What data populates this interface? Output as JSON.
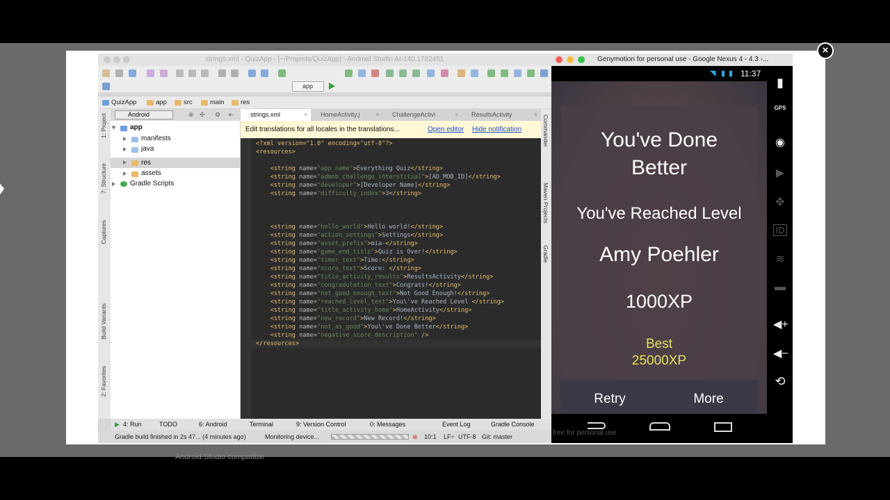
{
  "studio": {
    "title": "strings.xml - QuizApp - [~/Projects/QuizApp] - Android Studio AI-140.1782451",
    "run_config": "app",
    "breadcrumb": [
      "QuizApp",
      "app",
      "src",
      "main",
      "res"
    ],
    "project_view": "Android",
    "tree": [
      "app",
      "manifests",
      "java",
      "res",
      "assets",
      "Gradle Scripts"
    ],
    "tabs": [
      "strings.xml",
      "HomeActivity.j",
      "ChallengeActivi",
      "ResultsActivity"
    ],
    "notice": {
      "text": "Edit translations for all locales in the translations...",
      "open": "Open editor",
      "hide": "Hide notification"
    },
    "left_tools": [
      "1: Project",
      "7: Structure",
      "Captures",
      "Build Variants",
      "2: Favorites"
    ],
    "right_tools": [
      "Commander",
      "Maven Projects",
      "Gradle"
    ],
    "code": [
      {
        "kind": "decl",
        "text": "<?xml version=\"1.0\" encoding=\"utf-8\"?>"
      },
      {
        "kind": "tag",
        "text": "<resources>"
      },
      {
        "kind": "blank",
        "text": ""
      },
      {
        "kind": "str",
        "name": "app_name",
        "value": "Everything Quiz"
      },
      {
        "kind": "str",
        "name": "admob_challenge_interstitial",
        "value": "[AD_MOB_ID]"
      },
      {
        "kind": "str",
        "name": "developer",
        "value": "[Developer Name]"
      },
      {
        "kind": "str",
        "name": "difficulty_index",
        "value": "3"
      },
      {
        "kind": "blank",
        "text": ""
      },
      {
        "kind": "blank",
        "text": ""
      },
      {
        "kind": "blank",
        "text": ""
      },
      {
        "kind": "str",
        "name": "hello_world",
        "value": "Hello world!"
      },
      {
        "kind": "str",
        "name": "action_settings",
        "value": "Settings"
      },
      {
        "kind": "str",
        "name": "asset_prefix",
        "value": "mia-"
      },
      {
        "kind": "str",
        "name": "game_end_title",
        "value": "Quiz is Over!"
      },
      {
        "kind": "str",
        "name": "timer_text",
        "value": "Time:"
      },
      {
        "kind": "str",
        "name": "score_text",
        "value": "Score: "
      },
      {
        "kind": "str",
        "name": "title_activity_results",
        "value": "ResultsActivity"
      },
      {
        "kind": "str",
        "name": "congradulation_text",
        "value": "Congrats!"
      },
      {
        "kind": "str",
        "name": "not_good_enough_text",
        "value": "Not Good Enough!"
      },
      {
        "kind": "str",
        "name": "reached_level_text",
        "value": "You\\'ve Reached Level "
      },
      {
        "kind": "str",
        "name": "title_activity_home",
        "value": "HomeActivity"
      },
      {
        "kind": "str",
        "name": "new_record",
        "value": "New Record!"
      },
      {
        "kind": "str",
        "name": "not_as_good",
        "value": "You\\'ve Done Better"
      },
      {
        "kind": "empty",
        "name": "negative_score_description"
      },
      {
        "kind": "tag",
        "text": "</resources>"
      }
    ],
    "bottom_tabs": [
      "4: Run",
      "TODO",
      "6: Android",
      "Terminal",
      "9: Version Control",
      "0: Messages",
      "Event Log",
      "Gradle Console"
    ],
    "status": {
      "message": "Gradle build finished in 2s 47... (4 minutes ago)",
      "task": "Monitoring device...",
      "position": "10:1",
      "line_sep": "LF÷",
      "encoding": "UTF-8",
      "vcs": "Git: master"
    }
  },
  "geny": {
    "title": "Genymotion for personal use - Google Nexus 4 - 4.3 -...",
    "time": "11:37",
    "side": [
      "GPS"
    ],
    "watermark": "free for personal use"
  },
  "app": {
    "heading": "You've Done Better",
    "level_label": "You've Reached Level",
    "level_name": "Amy Poehler",
    "xp": "1000XP",
    "best_label": "Best",
    "best_value": "25000XP",
    "retry": "Retry",
    "more": "More"
  },
  "colors": {
    "best_text": "#e8e05a",
    "editor_bg": "#2b2b2b",
    "xml_tag": "#e8bf6a",
    "xml_value": "#6a8759"
  },
  "page": {
    "ghost": "Android Studio compatible"
  }
}
